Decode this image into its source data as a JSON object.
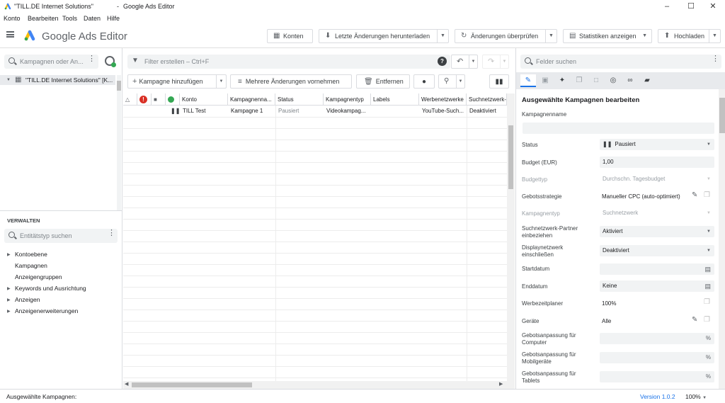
{
  "window": {
    "title": "\"TILL.DE Internet Solutions\"",
    "separator": "-",
    "app_name": "Google Ads Editor"
  },
  "menu": [
    "Konto",
    "Bearbeiten",
    "Tools",
    "Daten",
    "Hilfe"
  ],
  "brand": "Google Ads Editor",
  "top_buttons": {
    "accounts": "Konten",
    "download": "Letzte Änderungen herunterladen",
    "check": "Änderungen überprüfen",
    "stats": "Statistiken anzeigen",
    "upload": "Hochladen"
  },
  "left": {
    "search_placeholder": "Kampagnen oder An...",
    "tree_item": "\"TILL.DE Internet Solutions\" [K...",
    "manage_header": "VERWALTEN",
    "entity_search_placeholder": "Entitätstyp suchen",
    "nav": [
      {
        "label": "Kontoebene",
        "expandable": true
      },
      {
        "label": "Kampagnen",
        "expandable": false
      },
      {
        "label": "Anzeigengruppen",
        "expandable": false
      },
      {
        "label": "Keywords und Ausrichtung",
        "expandable": true
      },
      {
        "label": "Anzeigen",
        "expandable": true
      },
      {
        "label": "Anzeigenerweiterungen",
        "expandable": true
      }
    ]
  },
  "center": {
    "filter_placeholder": "Filter erstellen – Ctrl+F",
    "add_campaign": "Kampagne hinzufügen",
    "multi_changes": "Mehrere Änderungen vornehmen",
    "remove": "Entfernen",
    "columns": [
      "Konto",
      "Kampagnenna...",
      "Status",
      "Kampagnentyp",
      "Labels",
      "Werbenetzwerke",
      "Suchnetzwerk-..."
    ],
    "rows": [
      {
        "konto": "TILL Test",
        "kampagne": "Kampagne 1",
        "status": "Pausiert",
        "typ": "Videokampag...",
        "labels": "",
        "werbenetzwerke": "YouTube-Such...",
        "suchnetzwerk": "Deaktiviert"
      }
    ]
  },
  "right": {
    "search_placeholder": "Felder suchen",
    "heading": "Ausgewählte Kampagnen bearbeiten",
    "fields": {
      "name_label": "Kampagnenname",
      "status_label": "Status",
      "status_value": "Pausiert",
      "budget_label": "Budget (EUR)",
      "budget_value": "1,00",
      "budgettyp_label": "Budgettyp",
      "budgettyp_value": "Durchschn. Tagesbudget",
      "gebot_label": "Gebotsstrategie",
      "gebot_value": "Manueller CPC (auto-optimiert)",
      "kampagnentyp_label": "Kampagnentyp",
      "kampagnentyp_value": "Suchnetzwerk",
      "partner_label_1": "Suchnetzwerk-Partner",
      "partner_label_2": "einbeziehen",
      "partner_value": "Aktiviert",
      "display_label_1": "Displaynetzwerk",
      "display_label_2": "einschließen",
      "display_value": "Deaktiviert",
      "start_label": "Startdatum",
      "end_label": "Enddatum",
      "end_value": "Keine",
      "planer_label": "Werbezeitplaner",
      "planer_value": "100%",
      "geraete_label": "Geräte",
      "geraete_value": "Alle",
      "computer_label_1": "Gebotsanpassung für",
      "computer_label_2": "Computer",
      "mobil_label_1": "Gebotsanpassung für",
      "mobil_label_2": "Mobilgeräte",
      "tablet_label_1": "Gebotsanpassung für",
      "tablet_label_2": "Tablets",
      "percent": "%"
    }
  },
  "status": {
    "selected": "Ausgewählte Kampagnen:",
    "version": "Version 1.0.2",
    "zoom": "100%"
  }
}
